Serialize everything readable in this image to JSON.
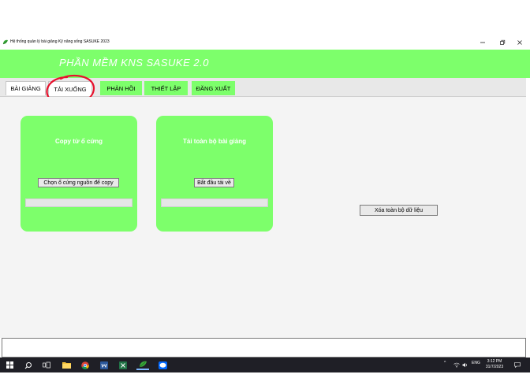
{
  "window": {
    "title": "Hệ thống quản lý bài giảng Kỹ năng sống SASUKE 2023",
    "minimize_icon": "minimize-icon",
    "maximize_icon": "restore-icon",
    "close_icon": "close-icon"
  },
  "header": {
    "app_title": "PHẦN MỀM KNS SASUKE 2.0",
    "background_color": "#7dff6b"
  },
  "tabs": [
    {
      "label": "BÀI GIẢNG",
      "style": "white"
    },
    {
      "label": "TẢI XUỐNG",
      "style": "white",
      "selected": true
    },
    {
      "label": "PHẢN HỒI",
      "style": "green"
    },
    {
      "label": "THIẾT LẬP",
      "style": "green"
    },
    {
      "label": "ĐĂNG XUẤT",
      "style": "green"
    }
  ],
  "cards": {
    "copy": {
      "title": "Copy từ ổ cứng",
      "button_label": "Chọn ổ cứng nguồn để copy",
      "progress": 0
    },
    "download": {
      "title": "Tải toàn bộ bài giảng",
      "button_label": "Bắt đầu tải về",
      "progress": 0
    }
  },
  "delete_button_label": "Xóa toàn bộ dữ liệu",
  "taskbar": {
    "items": [
      "windows-start-icon",
      "search-icon",
      "task-view-icon",
      "file-explorer-icon",
      "chrome-icon",
      "word-icon",
      "excel-icon",
      "sasuke-app-icon",
      "zalo-icon"
    ],
    "tray_arrow": "^",
    "language": "ENG",
    "time": "3:12 PM",
    "date": "31/7/2023"
  },
  "colors": {
    "accent_green": "#7dff6b",
    "annotation_red": "#e8112d",
    "taskbar": "#1f1f26"
  }
}
